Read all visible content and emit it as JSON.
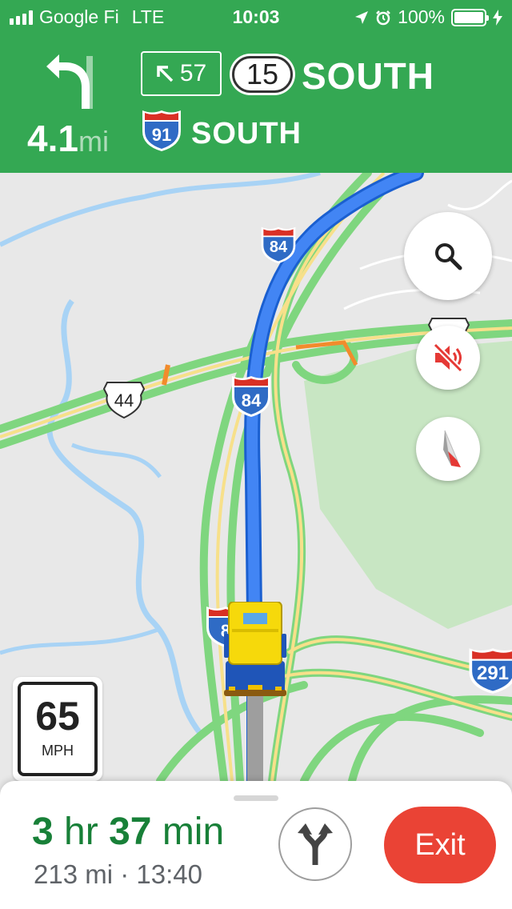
{
  "status_bar": {
    "carrier": "Google Fi",
    "network": "LTE",
    "time": "10:03",
    "battery": "100%",
    "icons": [
      "signal-icon",
      "location-arrow-icon",
      "alarm-icon",
      "battery-icon",
      "charging-icon"
    ]
  },
  "navigation": {
    "turn_icon": "turn-left-arrow-icon",
    "distance": "4.1",
    "distance_unit": "mi",
    "exit_number": "57",
    "exit_icon": "arrow-up-left-icon",
    "route_number": "15",
    "route_direction": "SOUTH",
    "next_route_number": "91",
    "next_route_direction": "SOUTH",
    "colors": {
      "header_bg": "#34a853",
      "route_line": "#3367d6",
      "traffic_green": "#7fd67f"
    }
  },
  "map": {
    "road_labels": [
      "84",
      "84",
      "44",
      "8",
      "291",
      "44"
    ],
    "buttons": {
      "search_icon": "search-icon",
      "mute_icon": "volume-mute-icon",
      "compass_icon": "compass-icon"
    },
    "speed_limit": {
      "value": "65",
      "unit": "MPH"
    }
  },
  "trip": {
    "hours": "3",
    "hours_unit": "hr",
    "minutes": "37",
    "minutes_unit": "min",
    "miles": "213 mi",
    "separator": "·",
    "arrival": "13:40",
    "alt_routes_icon": "alternate-routes-icon",
    "exit_label": "Exit",
    "colors": {
      "eta": "#188038",
      "exit_button": "#ea4335"
    }
  }
}
